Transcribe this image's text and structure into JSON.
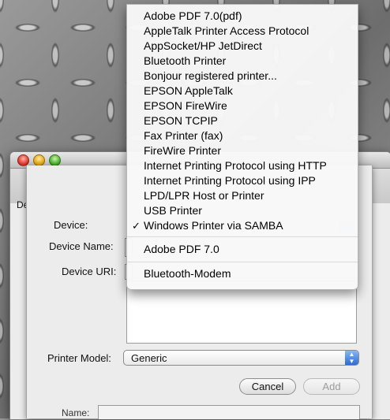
{
  "menu": {
    "items": [
      {
        "label": "Adobe PDF 7.0(pdf)"
      },
      {
        "label": "AppleTalk Printer Access Protocol"
      },
      {
        "label": "AppSocket/HP JetDirect"
      },
      {
        "label": "Bluetooth Printer"
      },
      {
        "label": "Bonjour registered printer..."
      },
      {
        "label": "EPSON AppleTalk"
      },
      {
        "label": "EPSON FireWire"
      },
      {
        "label": "EPSON TCPIP"
      },
      {
        "label": "Fax Printer (fax)"
      },
      {
        "label": "FireWire Printer"
      },
      {
        "label": "Internet Printing Protocol using HTTP"
      },
      {
        "label": "Internet Printing Protocol using IPP"
      },
      {
        "label": "LPD/LPR Host or Printer"
      },
      {
        "label": "USB Printer"
      },
      {
        "label": "Windows Printer via SAMBA",
        "checked": true
      },
      {
        "label": "Adobe PDF 7.0"
      },
      {
        "label": "Bluetooth-Modem"
      }
    ],
    "check_glyph": "✓"
  },
  "window": {
    "left_tab_label": "De"
  },
  "form": {
    "device_label": "Device:",
    "device_name_label": "Device Name:",
    "device_uri_label": "Device URI:",
    "printer_model_label": "Printer Model:",
    "printer_model_value": "Generic",
    "cancel_label": "Cancel",
    "add_label": "Add",
    "bottom_name_label": "Name:"
  },
  "colors": {
    "accent_blue": "#2a6bd6",
    "disabled_text": "#9c9c9c"
  }
}
